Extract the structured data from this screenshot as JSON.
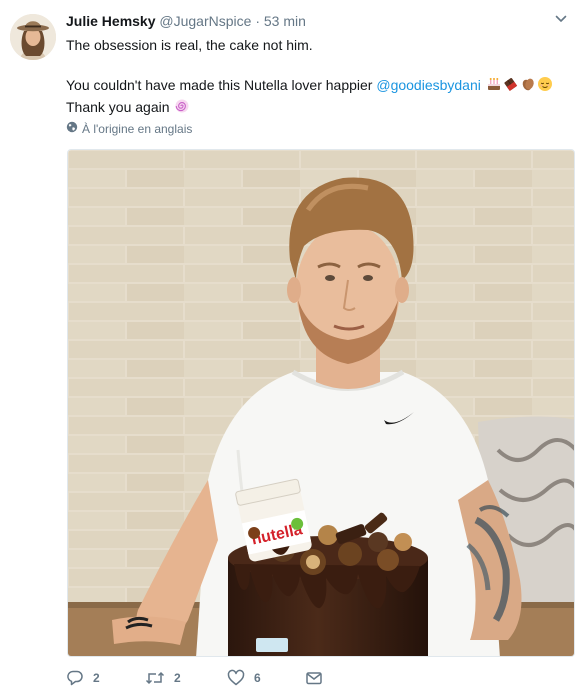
{
  "tweet": {
    "user": {
      "name": "Julie Hemsky",
      "handle": "@JugarNspice",
      "avatar_icon": "avatar-woman-with-hat"
    },
    "separator": "·",
    "time": "53 min",
    "text": {
      "line1": "The obsession is real, the cake not him.",
      "line2_prefix": "You couldn't have made this Nutella lover happier ",
      "mention": "@goodiesbydani",
      "line3": "Thank you again"
    },
    "emojis": [
      "birthday-cake",
      "chocolate-bar",
      "clapping-hands",
      "relieved-face",
      "cyclone"
    ],
    "translate_label": "À l'origine en anglais",
    "photo": {
      "alt_subject": "man-with-nutella-cake",
      "jar_label": "nutella"
    },
    "actions": {
      "reply_count": "2",
      "retweet_count": "2",
      "like_count": "6"
    },
    "colors": {
      "link": "#1b95e0",
      "secondary_text": "#657786",
      "brick": "#e8dcc8",
      "chocolate": "#3a2014"
    }
  }
}
